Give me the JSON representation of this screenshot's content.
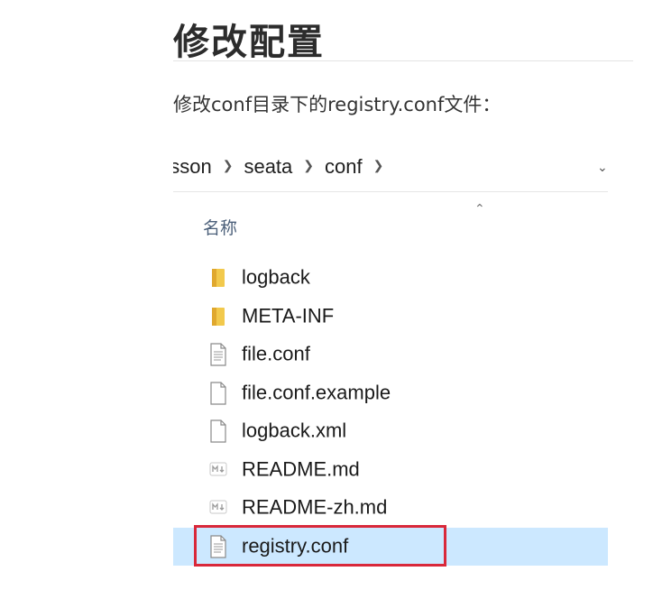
{
  "heading": "修改配置",
  "description": "修改conf目录下的registry.conf文件：",
  "explorer": {
    "breadcrumb": [
      "esson",
      "seata",
      "conf"
    ],
    "column_header": "名称",
    "files": [
      {
        "name": "logback",
        "icon": "folder-icon"
      },
      {
        "name": "META-INF",
        "icon": "folder-icon"
      },
      {
        "name": "file.conf",
        "icon": "text-file-icon"
      },
      {
        "name": "file.conf.example",
        "icon": "blank-file-icon"
      },
      {
        "name": "logback.xml",
        "icon": "blank-file-icon"
      },
      {
        "name": "README.md",
        "icon": "markdown-file-icon"
      },
      {
        "name": "README-zh.md",
        "icon": "markdown-file-icon"
      },
      {
        "name": "registry.conf",
        "icon": "text-file-icon",
        "selected": true
      }
    ]
  },
  "colors": {
    "selection": "#cce8ff",
    "highlight_border": "#d9283a",
    "folder": "#f2c94c",
    "header_text": "#4c607a"
  }
}
